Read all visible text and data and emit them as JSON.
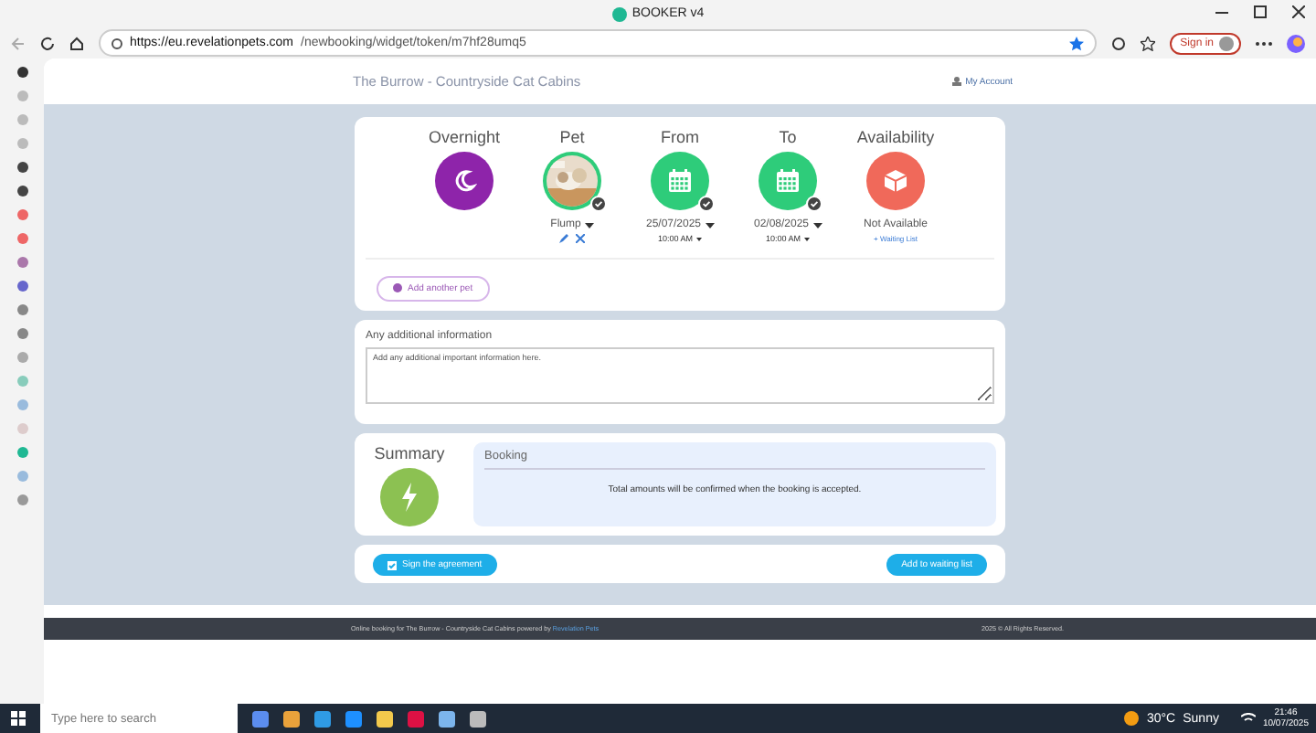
{
  "window": {
    "title": "BOOKER v4"
  },
  "address_bar": {
    "url_host": "https://eu.revelationpets.com",
    "url_path": "/newbooking/widget/token/m7hf28umq5",
    "sign_in": "Sign in"
  },
  "site": {
    "title": "The Burrow - Countryside Cat Cabins",
    "account": "My Account"
  },
  "booking": {
    "columns": [
      {
        "label": "Overnight",
        "kind": "moon",
        "color": "#8e24aa"
      },
      {
        "label": "Pet",
        "kind": "pet",
        "color": "#2ecc7a",
        "checked": true,
        "value": "Flump",
        "dropdown": true
      },
      {
        "label": "From",
        "kind": "date",
        "color": "#2ecc7a",
        "checked": true,
        "value": "25/07/2025",
        "dropdown": true,
        "time": "10:00 AM"
      },
      {
        "label": "To",
        "kind": "date",
        "color": "#2ecc7a",
        "checked": true,
        "value": "02/08/2025",
        "dropdown": true,
        "time": "10:00 AM"
      },
      {
        "label": "Availability",
        "kind": "box",
        "color": "#f0695a",
        "value": "Not Available",
        "link": "+ Waiting List"
      }
    ],
    "add_pet": "Add another pet"
  },
  "info": {
    "label": "Any additional information",
    "placeholder": "Add any additional important information here."
  },
  "summary": {
    "title": "Summary",
    "heading": "Booking",
    "note": "Total amounts will be confirmed when the booking is accepted."
  },
  "actions": {
    "sign": "Sign the agreement",
    "waiting": "Add to waiting list"
  },
  "footer": {
    "text": "Online booking for The Burrow - Countryside Cat Cabins powered by ",
    "link": "Revelation Pets",
    "copyright": "2025 © All Rights Reserved."
  },
  "taskbar": {
    "search_placeholder": "Type here to search",
    "temperature": "30°C",
    "weather": "Sunny",
    "time": "21:46",
    "date": "10/07/2025"
  }
}
